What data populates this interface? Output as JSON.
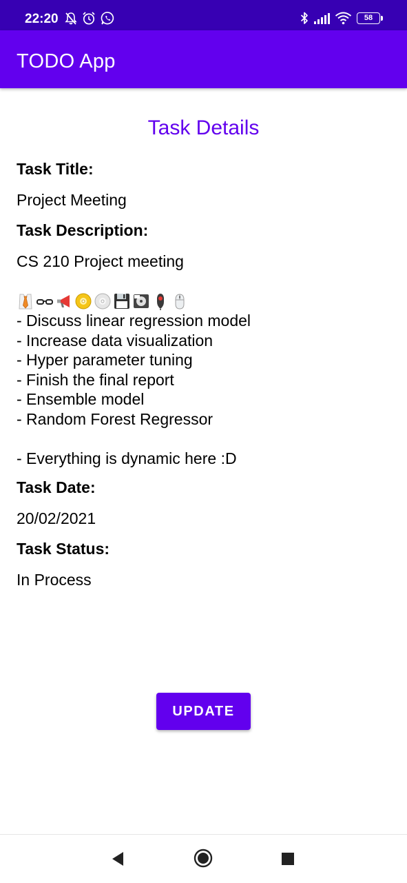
{
  "status_bar": {
    "time": "22:20",
    "battery_level": "58",
    "icons": [
      "notifications-off-icon",
      "alarm-icon",
      "whatsapp-icon",
      "bluetooth-icon",
      "signal-icon",
      "wifi-icon",
      "battery-icon"
    ]
  },
  "app_bar": {
    "title": "TODO App"
  },
  "page": {
    "title": "Task Details"
  },
  "task": {
    "title_label": "Task Title:",
    "title_value": "Project Meeting",
    "description_label": "Task Description:",
    "description_first_line": "CS 210 Project meeting",
    "description_emojis": [
      "necktie-emoji",
      "glasses-emoji",
      "megaphone-emoji",
      "dvd-emoji",
      "cd-emoji",
      "floppy-disk-emoji",
      "minidisc-emoji",
      "computer-mouse-emoji",
      "mouse-emoji"
    ],
    "description_lines": [
      "- Discuss linear regression model",
      "- Increase data visualization",
      "- Hyper parameter tuning",
      "- Finish the final report",
      "- Ensemble model",
      "- Random Forest Regressor",
      "",
      "- Everything is dynamic here :D"
    ],
    "date_label": "Task Date:",
    "date_value": "20/02/2021",
    "status_label": "Task Status:",
    "status_value": "In Process"
  },
  "actions": {
    "update_label": "UPDATE"
  },
  "nav_bar": {
    "buttons": [
      "back-icon",
      "home-icon",
      "recents-icon"
    ]
  },
  "colors": {
    "status_bar": "#3700b3",
    "primary": "#6200ee",
    "text": "#000000",
    "on_primary": "#ffffff"
  }
}
